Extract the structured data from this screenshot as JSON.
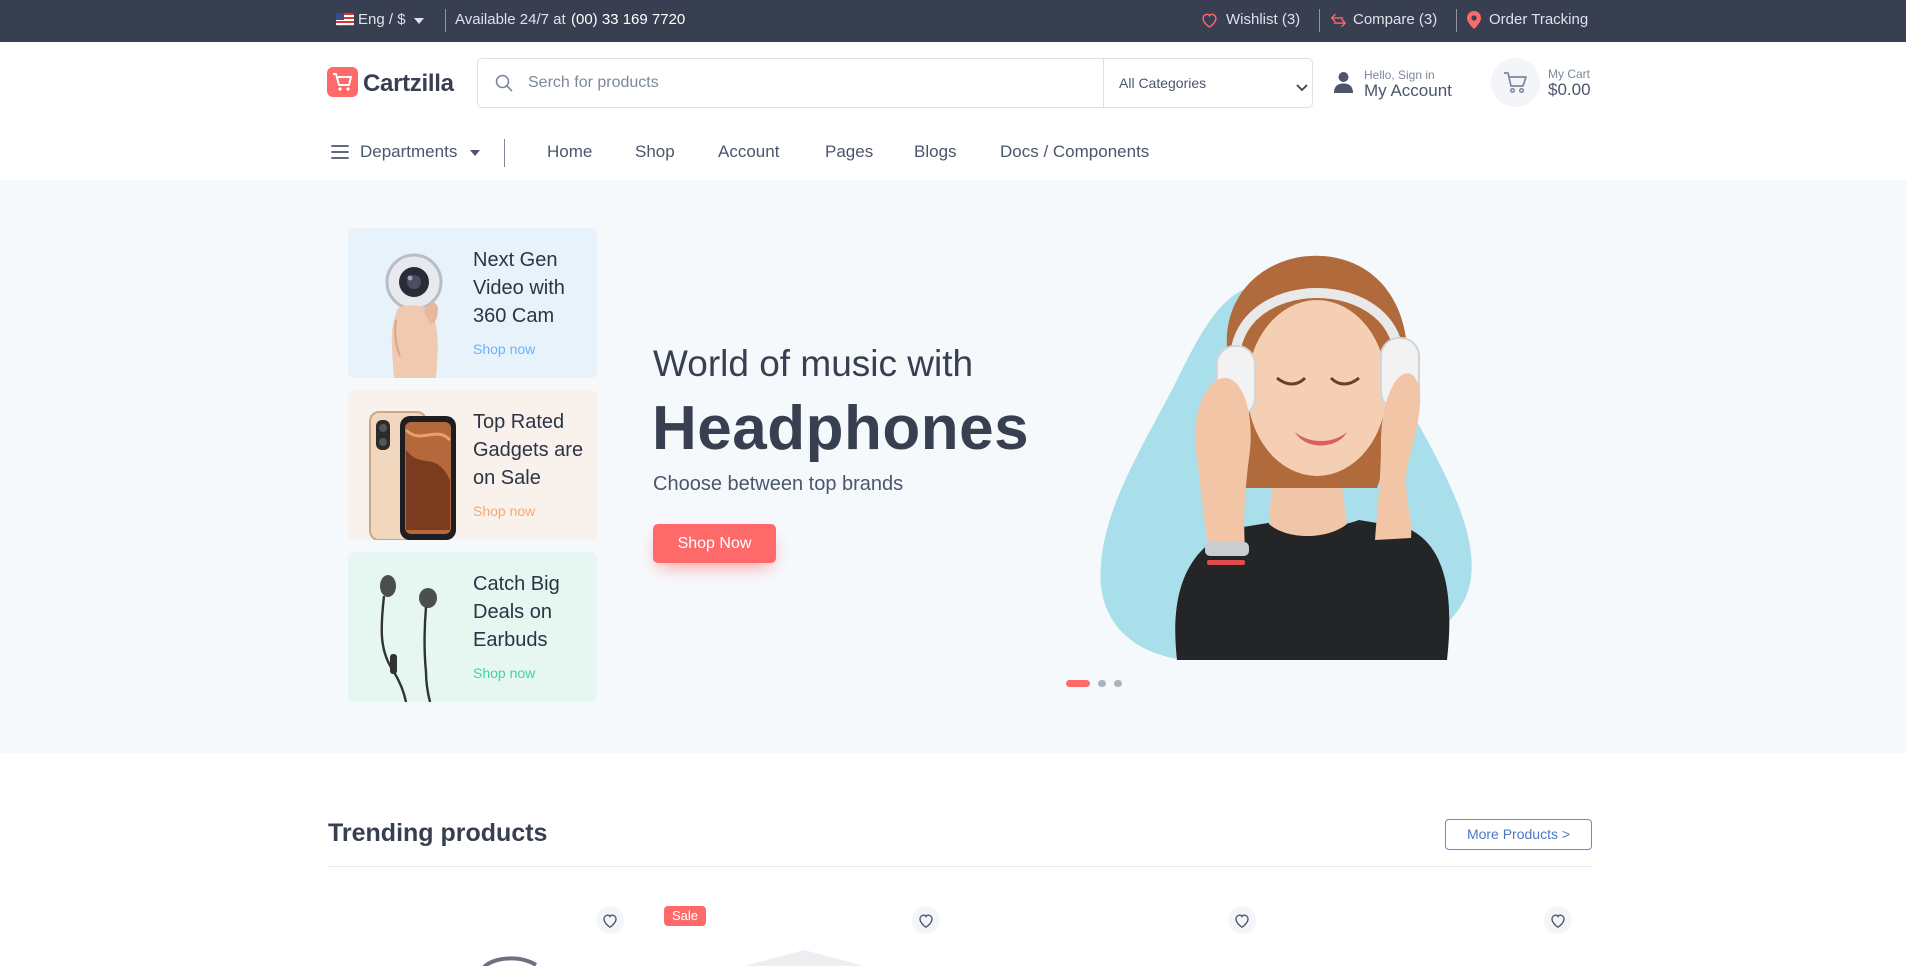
{
  "topbar": {
    "locale": "Eng / $",
    "availability": "Available 24/7 at",
    "phone": "(00) 33 169 7720",
    "wishlist": "Wishlist (3)",
    "compare": "Compare (3)",
    "order_tracking": "Order Tracking"
  },
  "header": {
    "logo": "Cartzilla",
    "search_placeholder": "Serch for products",
    "category_select": "All Categories",
    "account_greeting": "Hello, Sign in",
    "account_label": "My Account",
    "cart_label": "My Cart",
    "cart_total": "$0.00"
  },
  "nav": {
    "departments": "Departments",
    "links": [
      "Home",
      "Shop",
      "Account",
      "Pages",
      "Blogs",
      "Docs / Components"
    ]
  },
  "promos": [
    {
      "title": "Next Gen Video with 360 Cam",
      "link": "Shop now",
      "bg": "#e8f2fb",
      "link_color": "#69b3fe"
    },
    {
      "title": "Top Rated Gadgets are on Sale",
      "link": "Shop now",
      "bg": "#f9f1ec",
      "link_color": "#fea569"
    },
    {
      "title": "Catch Big Deals on Earbuds",
      "link": "Shop now",
      "bg": "#e6f6f1",
      "link_color": "#42d697"
    }
  ],
  "hero": {
    "subtitle": "World of music with",
    "title": "Headphones",
    "description": "Choose between top brands",
    "button": "Shop Now",
    "active_slide": 1,
    "slide_count": 3
  },
  "trending": {
    "title": "Trending products",
    "more_button": "More Products >",
    "sale_badge": "Sale"
  },
  "colors": {
    "accent": "#fe696a",
    "dark": "#373f50",
    "hero_bg": "#f6f9fc",
    "blob": "#a8dfeb"
  }
}
